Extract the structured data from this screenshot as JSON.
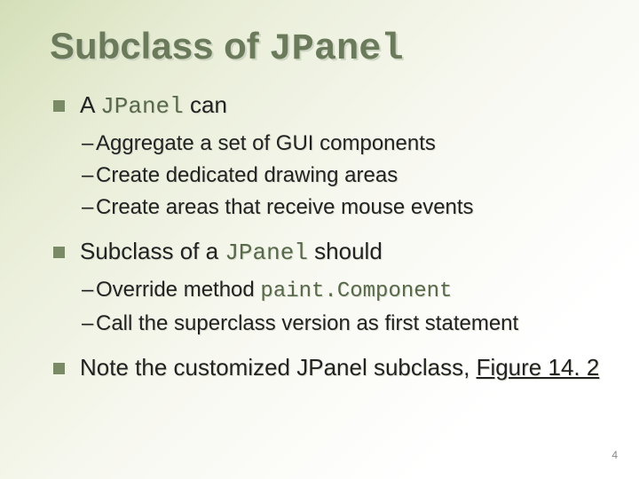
{
  "title_pre": "Subclass of ",
  "title_code": "JPanel",
  "bullets": [
    {
      "line_pre": "A ",
      "line_code": "JPanel",
      "line_post": " can",
      "sub": [
        "Aggregate a set of GUI components",
        "Create dedicated drawing areas",
        "Create areas that receive mouse events"
      ]
    },
    {
      "line_pre": "Subclass of a ",
      "line_code": "JPanel",
      "line_post": " should",
      "sub_rich": [
        {
          "pre": "Override method ",
          "code": "paint.Component",
          "post": ""
        },
        {
          "pre": "Call the superclass version as first statement",
          "code": "",
          "post": ""
        }
      ]
    },
    {
      "line_pre": "Note the customized JPanel subclass, ",
      "link": "Figure 14. 2"
    }
  ],
  "page_number": "4"
}
